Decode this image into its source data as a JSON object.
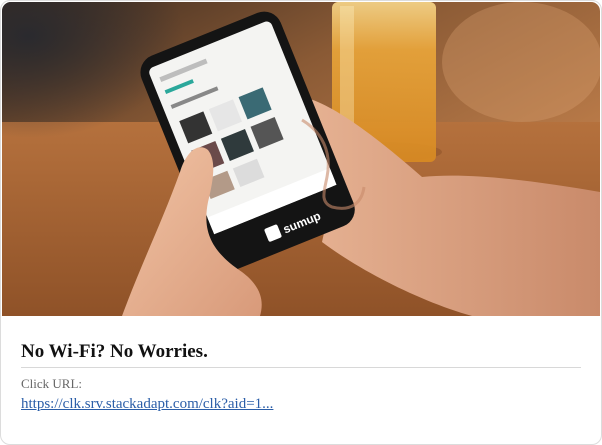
{
  "ad": {
    "title": "No Wi-Fi? No Worries.",
    "click_label": "Click URL:",
    "click_url": "https://clk.srv.stackadapt.com/clk?aid=1...",
    "image_brand": "sumup"
  }
}
